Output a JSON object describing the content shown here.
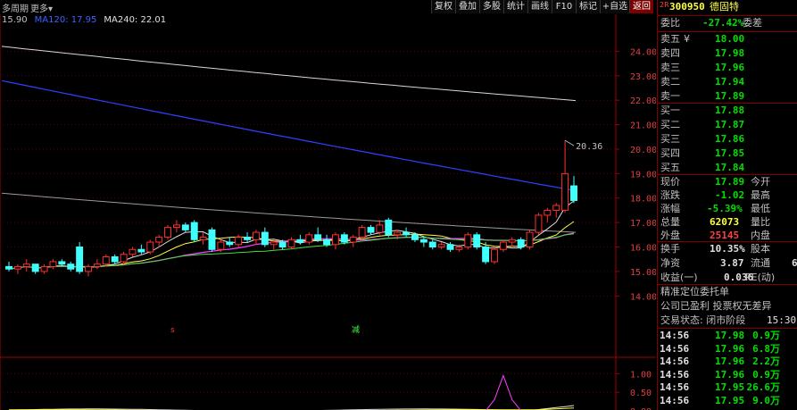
{
  "toolbar": {
    "period_label": "多周期",
    "more_label": "更多",
    "buttons": [
      "复权",
      "叠加",
      "多股",
      "统计",
      "画线",
      "F10",
      "标记",
      "+自选",
      "返回"
    ]
  },
  "ma_legend": {
    "ma_cut": "15.90",
    "ma120": "MA120: 17.95",
    "ma240": "MA240: 22.01"
  },
  "chart_data": {
    "type": "candlestick",
    "price_axis": [
      "24.00",
      "23.00",
      "22.00",
      "21.00",
      "20.00",
      "19.00",
      "18.00",
      "17.00",
      "16.00",
      "15.00",
      "14.00"
    ],
    "ylim": [
      13.5,
      25.0
    ],
    "high_label": "20.36",
    "indicator_axis": [
      "1.00",
      "0.50",
      "0.00"
    ],
    "indicator_ylim": [
      -0.05,
      1.2
    ],
    "marker_labels": [
      "s",
      "减"
    ],
    "candles": [
      [
        15.2,
        15.4,
        15.0,
        15.1
      ],
      [
        15.1,
        15.3,
        14.9,
        15.2
      ],
      [
        15.2,
        15.5,
        15.0,
        15.3
      ],
      [
        15.3,
        15.3,
        14.9,
        15.0
      ],
      [
        15.0,
        15.3,
        14.9,
        15.2
      ],
      [
        15.2,
        15.5,
        15.1,
        15.4
      ],
      [
        15.4,
        15.5,
        15.2,
        15.3
      ],
      [
        15.3,
        15.4,
        15.0,
        15.1
      ],
      [
        16.0,
        16.2,
        14.9,
        15.0
      ],
      [
        15.0,
        15.3,
        14.8,
        15.2
      ],
      [
        15.2,
        15.5,
        15.1,
        15.3
      ],
      [
        15.3,
        15.7,
        15.2,
        15.6
      ],
      [
        15.6,
        15.7,
        15.3,
        15.4
      ],
      [
        15.4,
        15.8,
        15.3,
        15.7
      ],
      [
        15.7,
        16.0,
        15.6,
        15.9
      ],
      [
        15.9,
        16.1,
        15.7,
        15.8
      ],
      [
        15.8,
        16.3,
        15.7,
        16.2
      ],
      [
        16.2,
        16.5,
        16.0,
        16.4
      ],
      [
        16.4,
        16.9,
        16.3,
        16.8
      ],
      [
        16.8,
        17.1,
        16.6,
        16.9
      ],
      [
        16.9,
        17.0,
        16.6,
        16.7
      ],
      [
        17.0,
        17.1,
        16.2,
        16.3
      ],
      [
        16.3,
        16.6,
        16.1,
        16.4
      ],
      [
        16.7,
        16.8,
        15.8,
        15.9
      ],
      [
        15.9,
        16.3,
        15.8,
        16.2
      ],
      [
        16.2,
        16.4,
        16.0,
        16.1
      ],
      [
        16.1,
        16.5,
        16.0,
        16.4
      ],
      [
        16.4,
        16.6,
        16.2,
        16.3
      ],
      [
        16.3,
        16.7,
        16.1,
        16.6
      ],
      [
        16.6,
        16.8,
        16.0,
        16.1
      ],
      [
        16.1,
        16.3,
        15.9,
        16.2
      ],
      [
        16.2,
        16.3,
        15.9,
        16.0
      ],
      [
        16.0,
        16.4,
        15.9,
        16.3
      ],
      [
        16.3,
        16.5,
        16.1,
        16.2
      ],
      [
        16.2,
        16.6,
        16.1,
        16.5
      ],
      [
        16.5,
        16.8,
        16.2,
        16.3
      ],
      [
        16.3,
        16.5,
        16.0,
        16.1
      ],
      [
        16.1,
        16.6,
        15.9,
        16.5
      ],
      [
        16.5,
        16.6,
        16.1,
        16.2
      ],
      [
        16.2,
        16.5,
        16.0,
        16.4
      ],
      [
        16.4,
        16.9,
        16.3,
        16.8
      ],
      [
        16.8,
        16.9,
        16.5,
        16.6
      ],
      [
        16.6,
        17.1,
        16.5,
        16.9
      ],
      [
        17.1,
        17.2,
        16.4,
        16.5
      ],
      [
        16.5,
        16.7,
        16.3,
        16.6
      ],
      [
        16.6,
        16.8,
        16.4,
        16.5
      ],
      [
        16.5,
        16.6,
        16.2,
        16.3
      ],
      [
        16.3,
        16.4,
        16.0,
        16.2
      ],
      [
        16.2,
        16.3,
        15.9,
        16.0
      ],
      [
        16.0,
        16.2,
        15.9,
        16.1
      ],
      [
        16.1,
        16.2,
        15.8,
        15.9
      ],
      [
        15.9,
        16.1,
        15.8,
        16.0
      ],
      [
        16.0,
        16.6,
        15.9,
        16.5
      ],
      [
        16.5,
        16.6,
        15.9,
        16.0
      ],
      [
        16.0,
        16.2,
        15.3,
        15.4
      ],
      [
        15.4,
        16.0,
        15.3,
        15.9
      ],
      [
        15.9,
        16.3,
        15.8,
        16.2
      ],
      [
        16.2,
        16.4,
        16.0,
        16.3
      ],
      [
        16.3,
        16.4,
        15.9,
        16.0
      ],
      [
        16.0,
        16.7,
        15.9,
        16.6
      ],
      [
        16.6,
        17.4,
        16.5,
        17.3
      ],
      [
        17.3,
        17.6,
        17.0,
        17.5
      ],
      [
        17.5,
        17.8,
        17.2,
        17.7
      ],
      [
        17.5,
        20.36,
        17.4,
        19.0
      ],
      [
        18.5,
        18.9,
        17.8,
        17.9
      ]
    ]
  },
  "panel": {
    "code": "300950",
    "name": "德固特",
    "weibi_label": "委比",
    "weibi_value": "-27.42%",
    "weicha_label": "委差",
    "asks": [
      {
        "label": "卖五",
        "tag": "¥",
        "price": "18.00"
      },
      {
        "label": "卖四",
        "tag": "",
        "price": "17.98"
      },
      {
        "label": "卖三",
        "tag": "",
        "price": "17.96"
      },
      {
        "label": "卖二",
        "tag": "",
        "price": "17.94"
      },
      {
        "label": "卖一",
        "tag": "",
        "price": "17.89"
      }
    ],
    "bids": [
      {
        "label": "买一",
        "price": "17.88"
      },
      {
        "label": "买二",
        "price": "17.87"
      },
      {
        "label": "买三",
        "price": "17.86"
      },
      {
        "label": "买四",
        "price": "17.85"
      },
      {
        "label": "买五",
        "price": "17.84"
      }
    ],
    "stats": [
      {
        "l1": "现价",
        "v1": "17.89",
        "l2": "今开"
      },
      {
        "l1": "涨跌",
        "v1": "-1.02",
        "l2": "最高"
      },
      {
        "l1": "涨幅",
        "v1": "-5.39%",
        "l2": "最低"
      },
      {
        "l1": "总量",
        "v1": "62073",
        "l2": "量比"
      },
      {
        "l1": "外盘",
        "v1": "25145",
        "l2": "内盘"
      }
    ],
    "stats2": [
      {
        "l1": "换手",
        "v1": "10.35%",
        "l2": "股本"
      },
      {
        "l1": "净资",
        "v1": "3.87",
        "l2": "流通",
        "v2": "6"
      },
      {
        "l1": "收益(一)",
        "v1": "0.036",
        "l2": "PE(动)"
      }
    ],
    "line_precise": "精准定位委托单",
    "line_company": "公司已盈利 投票权无差异",
    "trade_status_label": "交易状态: 闭市阶段",
    "trade_time": "15:30:0",
    "ticks": [
      {
        "time": "14:56",
        "price": "17.98",
        "vol": "0.9万"
      },
      {
        "time": "14:56",
        "price": "17.96",
        "vol": "6.8万"
      },
      {
        "time": "14:56",
        "price": "17.96",
        "vol": "2.2万"
      },
      {
        "time": "14:56",
        "price": "17.96",
        "vol": "0.9万"
      },
      {
        "time": "14:56",
        "price": "17.95",
        "vol": "26.6万"
      },
      {
        "time": "14:56",
        "price": "17.95",
        "vol": "9.0万"
      }
    ]
  }
}
